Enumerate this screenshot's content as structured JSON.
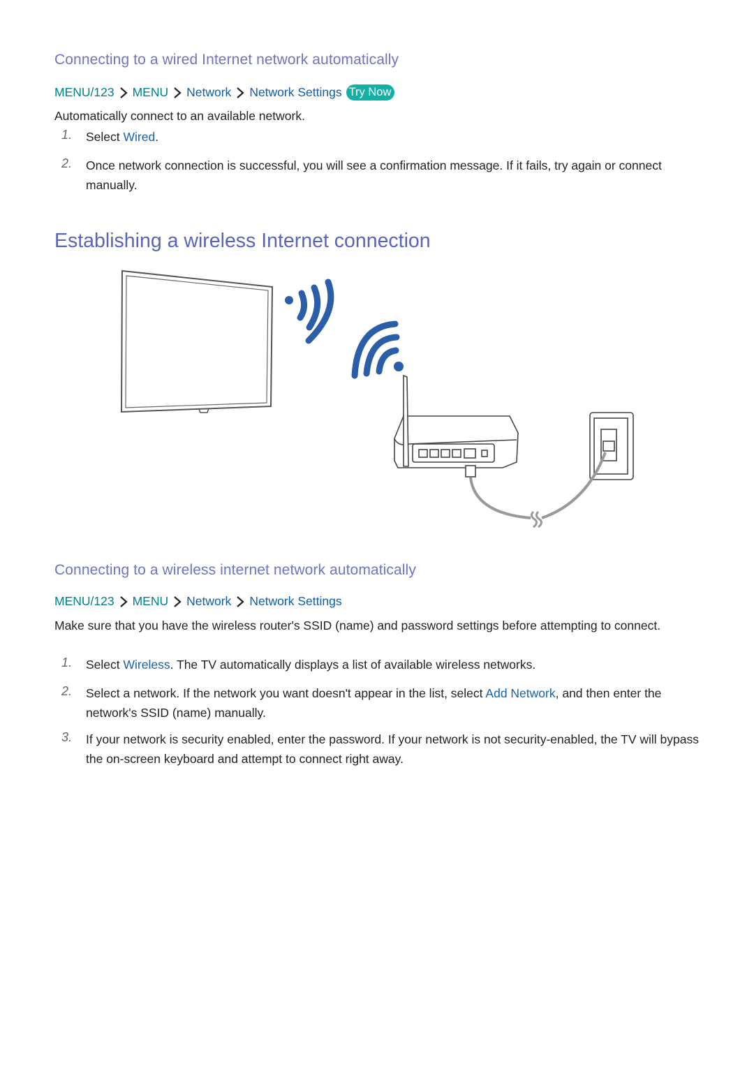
{
  "section_wired": {
    "heading": "Connecting to a wired Internet network automatically",
    "breadcrumb": [
      "MENU/123",
      "MENU",
      "Network",
      "Network Settings"
    ],
    "try_now": "Try Now",
    "intro": "Automatically connect to an available network.",
    "steps": [
      {
        "number": "1.",
        "pre": "Select ",
        "keyword": "Wired",
        "post": "."
      },
      {
        "number": "2.",
        "pre": "Once network connection is successful, you will see a confirmation message. If it fails, try again or connect manually.",
        "keyword": "",
        "post": ""
      }
    ]
  },
  "section_wireless_title": "Establishing a wireless Internet connection",
  "illustration": {
    "description": "TV receiving Wi-Fi signal from a router connected by cable to a wall outlet",
    "icons": [
      "tv-icon",
      "wifi-signal-icon",
      "router-icon",
      "wall-jack-icon",
      "cable-icon"
    ]
  },
  "section_wireless": {
    "heading": "Connecting to a wireless internet network automatically",
    "breadcrumb": [
      "MENU/123",
      "MENU",
      "Network",
      "Network Settings"
    ],
    "intro": "Make sure that you have the wireless router's SSID (name) and password settings before attempting to connect.",
    "steps": [
      {
        "number": "1.",
        "pre": "Select ",
        "keyword": "Wireless",
        "post": ". The TV automatically displays a list of available wireless networks."
      },
      {
        "number": "2.",
        "pre": "Select a network. If the network you want doesn't appear in the list, select ",
        "keyword": "Add Network",
        "post": ", and then enter the network's SSID (name) manually."
      },
      {
        "number": "3.",
        "pre": "If your network is security enabled, enter the password. If your network is not security-enabled, the TV will bypass the on-screen keyboard and attempt to connect right away.",
        "keyword": "",
        "post": ""
      }
    ]
  },
  "colors": {
    "heading": "#6f74c0",
    "title": "#5a64bb",
    "breadcrumb_teal": "#00808a",
    "breadcrumb_blue": "#0c5ea8",
    "try_now_bg": "#13b0a6",
    "wifi_blue": "#2a5ea8"
  }
}
